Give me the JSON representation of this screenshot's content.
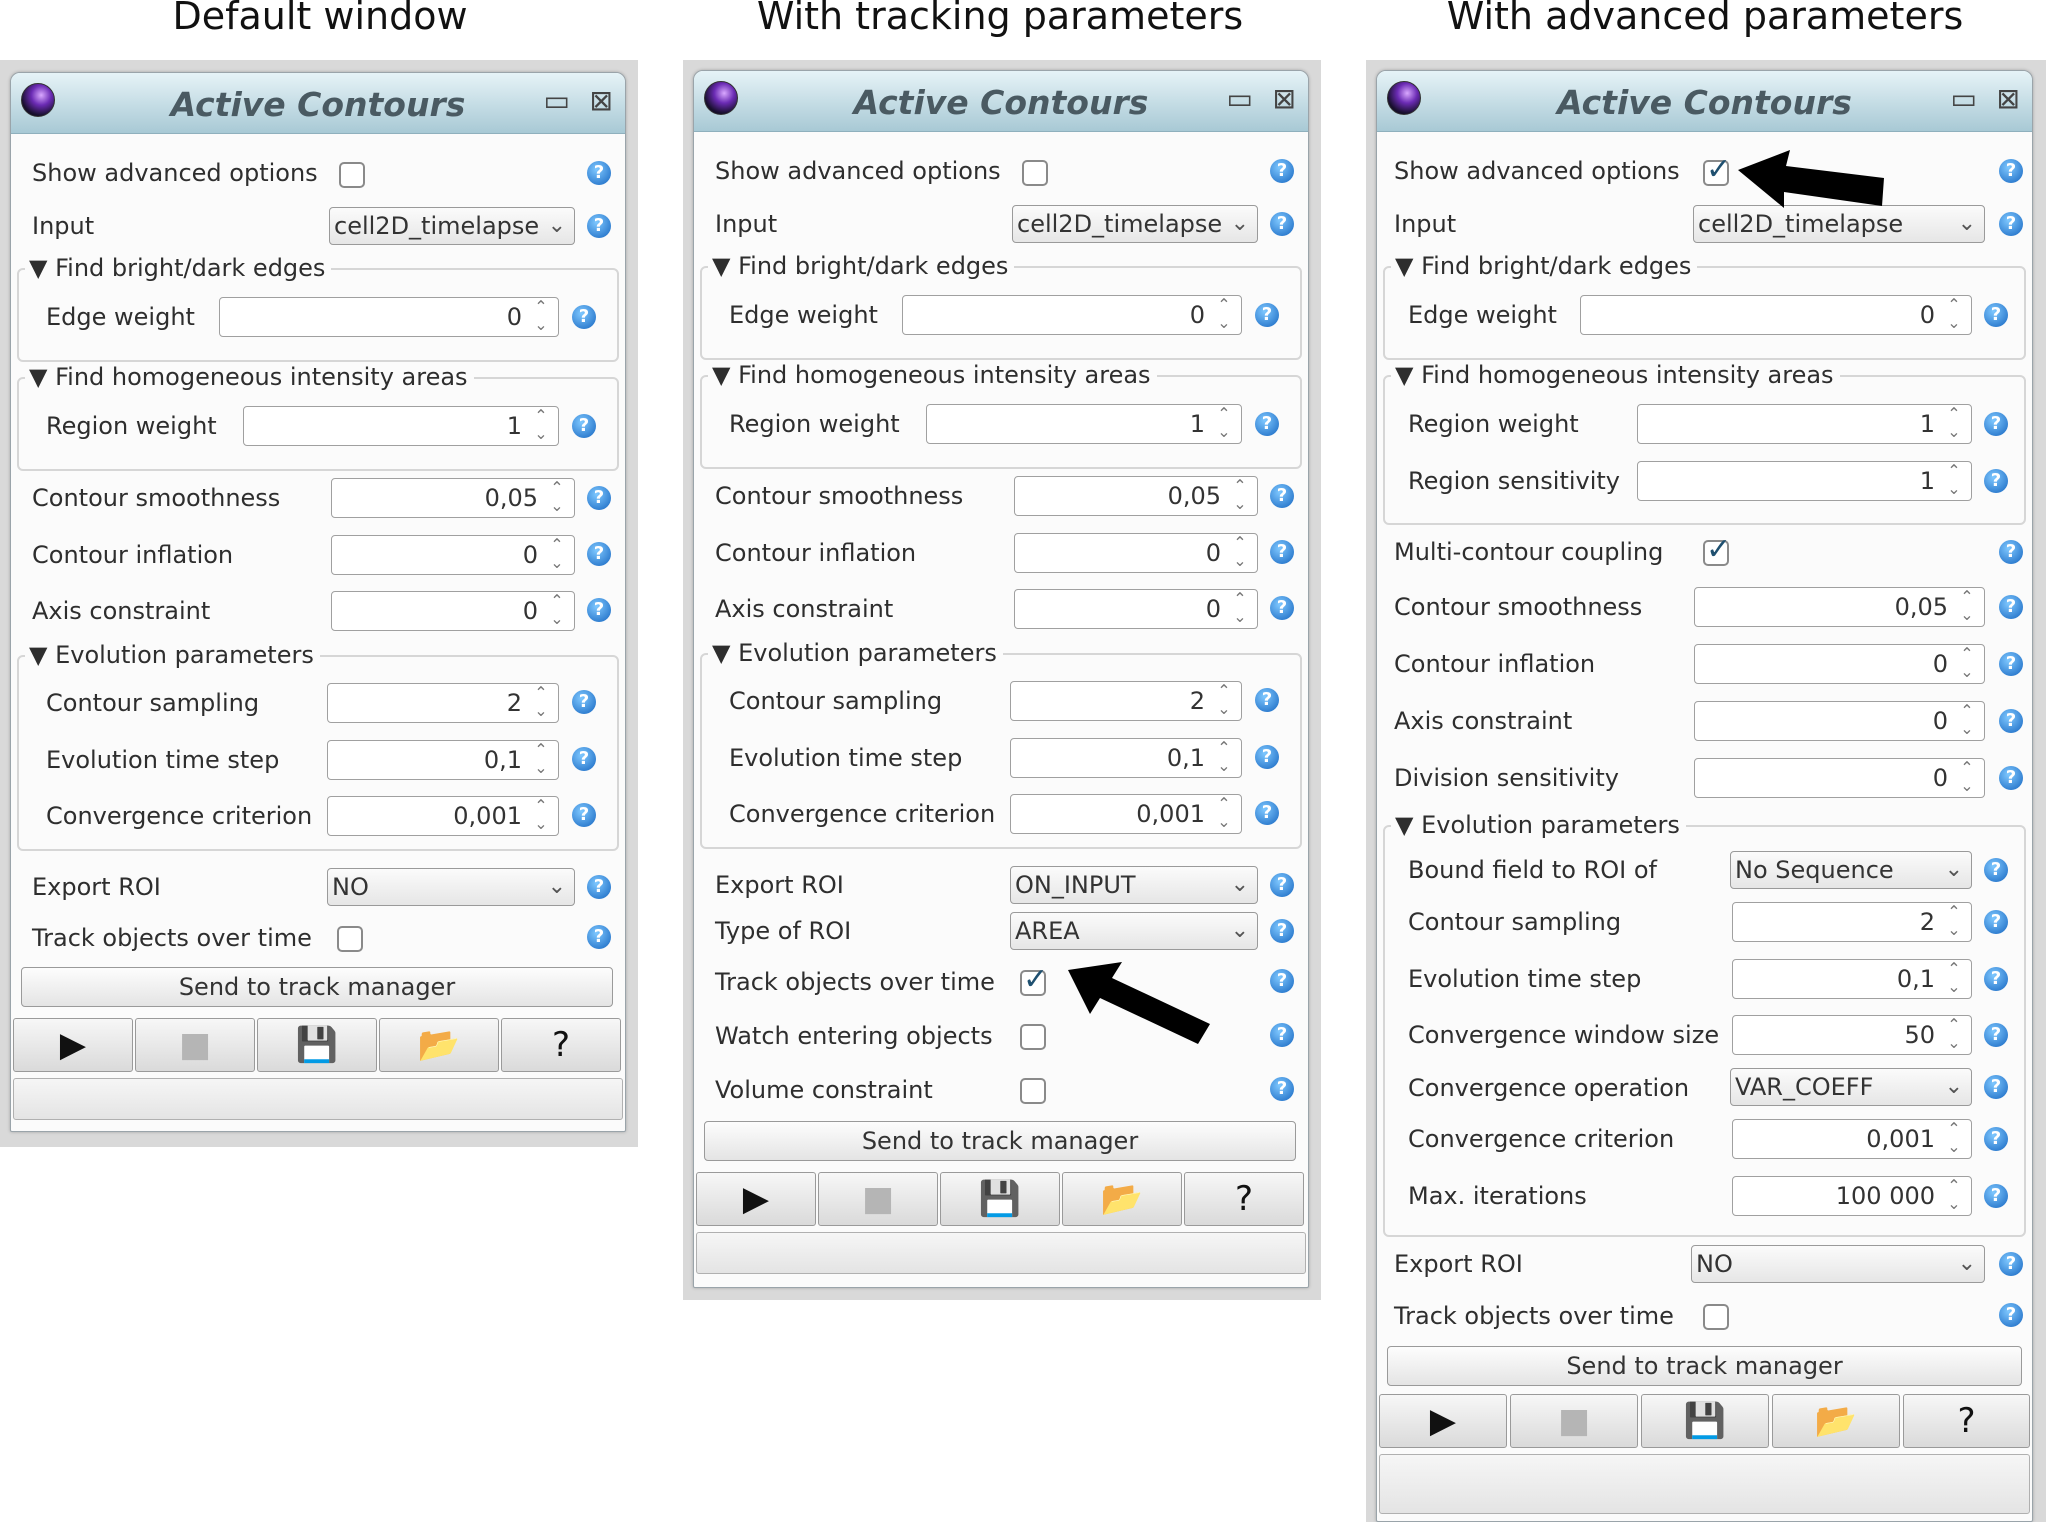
{
  "captions": [
    "Default window",
    "With tracking parameters",
    "With advanced parameters"
  ],
  "window_title": "Active Contours",
  "icons": {
    "minimize": "▭",
    "close": "⊠",
    "help": "?",
    "play": "▶",
    "stop": "■",
    "save": "💾",
    "open": "📂",
    "question": "?"
  },
  "labels": {
    "show_advanced": "Show advanced options",
    "input": "Input",
    "find_edges": "▼ Find bright/dark edges",
    "edge_weight": "Edge weight",
    "find_homog": "▼ Find homogeneous intensity areas",
    "region_weight": "Region weight",
    "region_sensitivity": "Region sensitivity",
    "multi_coupling": "Multi-contour coupling",
    "contour_smoothness": "Contour smoothness",
    "contour_inflation": "Contour inflation",
    "axis_constraint": "Axis constraint",
    "division_sensitivity": "Division sensitivity",
    "evolution_params": "▼ Evolution parameters",
    "bound_field": "Bound field to ROI of",
    "contour_sampling": "Contour sampling",
    "evolution_time_step": "Evolution time step",
    "conv_window": "Convergence window size",
    "conv_operation": "Convergence operation",
    "conv_criterion": "Convergence criterion",
    "max_iterations": "Max. iterations",
    "export_roi": "Export ROI",
    "type_of_roi": "Type of ROI",
    "track_objects": "Track objects over time",
    "watch_entering": "Watch entering objects",
    "volume_constraint": "Volume constraint",
    "send_to_track": "Send to track manager"
  },
  "values": {
    "input": "cell2D_timelapse",
    "edge_weight": "0",
    "region_weight": "1",
    "region_sensitivity": "1",
    "contour_smoothness": "0,05",
    "contour_inflation": "0",
    "axis_constraint": "0",
    "division_sensitivity": "0",
    "bound_field": "No Sequence",
    "contour_sampling": "2",
    "evolution_time_step": "0,1",
    "conv_window": "50",
    "conv_operation": "VAR_COEFF",
    "conv_criterion": "0,001",
    "max_iterations": "100 000",
    "export_roi_default": "NO",
    "export_roi_tracking": "ON_INPUT",
    "type_of_roi": "AREA"
  },
  "checks": {
    "window1": {
      "show_advanced": false,
      "track_objects": false
    },
    "window2": {
      "show_advanced": false,
      "track_objects": true,
      "watch_entering": false,
      "volume_constraint": false
    },
    "window3": {
      "show_advanced": true,
      "multi_coupling": true,
      "track_objects": false
    }
  },
  "colors": {
    "titlebar": "#a8c9d5",
    "help": "#1565c0",
    "arrow": "#000000"
  }
}
